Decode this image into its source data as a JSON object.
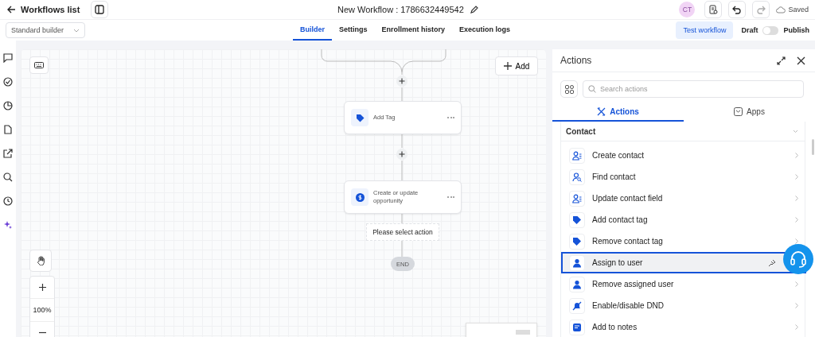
{
  "header": {
    "back_label": "Workflows list",
    "title": "New Workflow : 1786632449542",
    "avatar": "CT",
    "status": "Saved"
  },
  "toolbar": {
    "builder_mode": "Standard builder",
    "tabs": [
      {
        "label": "Builder",
        "selected": true
      },
      {
        "label": "Settings",
        "selected": false
      },
      {
        "label": "Enrollment history",
        "selected": false
      },
      {
        "label": "Execution logs",
        "selected": false
      }
    ],
    "test_button": "Test workflow",
    "draft_label": "Draft",
    "publish_label": "Publish",
    "publish_toggle": {
      "on": false
    }
  },
  "canvas": {
    "add_button": "Add",
    "nodes": [
      {
        "kind": "tag",
        "label": "Add Tag"
      },
      {
        "kind": "money",
        "label": "Create or update opportunity"
      }
    ],
    "warning": "Please select action",
    "end_label": "END",
    "zoom": "100%"
  },
  "panel": {
    "title": "Actions",
    "search": {
      "placeholder": "Search actions"
    },
    "tabs": [
      {
        "label": "Actions",
        "selected": true
      },
      {
        "label": "Apps",
        "selected": false
      }
    ],
    "section": {
      "title": "Contact",
      "items": [
        {
          "kind": "person",
          "label": "Create contact",
          "selected": false
        },
        {
          "kind": "find",
          "label": "Find contact",
          "selected": false
        },
        {
          "kind": "person",
          "label": "Update contact field",
          "selected": false
        },
        {
          "kind": "tag",
          "label": "Add contact tag",
          "selected": false
        },
        {
          "kind": "tag",
          "label": "Remove contact tag",
          "selected": false
        },
        {
          "kind": "user",
          "label": "Assign to user",
          "selected": true
        },
        {
          "kind": "user",
          "label": "Remove assigned user",
          "selected": false
        },
        {
          "kind": "dnd",
          "label": "Enable/disable DND",
          "selected": false
        },
        {
          "kind": "note",
          "label": "Add to notes",
          "selected": false
        }
      ]
    }
  }
}
